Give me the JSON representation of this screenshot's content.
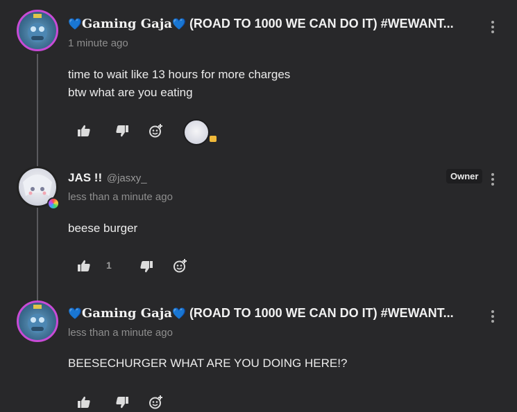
{
  "comments": [
    {
      "author_prefix_heart": "💙",
      "author_name": "𝐆𝐚𝐦𝐢𝐧𝐠 𝐆𝐚𝐣𝐚",
      "author_suffix_heart": "💙",
      "author_tagline": "(ROAD TO 1000 WE CAN DO IT) #WEWANT...",
      "timestamp": "1 minute ago",
      "lines": [
        "time to wait like 13 hours for more charges",
        "btw what are you eating"
      ]
    },
    {
      "author_name": "JAS !!",
      "handle": "@jasxy_",
      "badge": "Owner",
      "timestamp": "less than a minute ago",
      "lines": [
        "beese burger"
      ],
      "like_count": "1"
    },
    {
      "author_prefix_heart": "💙",
      "author_name": "𝐆𝐚𝐦𝐢𝐧𝐠 𝐆𝐚𝐣𝐚",
      "author_suffix_heart": "💙",
      "author_tagline": "(ROAD TO 1000 WE CAN DO IT) #WEWANT...",
      "timestamp": "less than a minute ago",
      "lines": [
        "BEESECHURGER WHAT ARE YOU DOING HERE!?"
      ]
    }
  ],
  "icons": {
    "like": "thumbs-up-icon",
    "dislike": "thumbs-down-icon",
    "react": "add-reaction-icon",
    "menu": "more-vertical-icon"
  },
  "colors": {
    "background": "#28282a",
    "avatar_ring": "#c84bd6",
    "heart": "#3ea2ff",
    "thread_line": "#5a5a5e"
  }
}
